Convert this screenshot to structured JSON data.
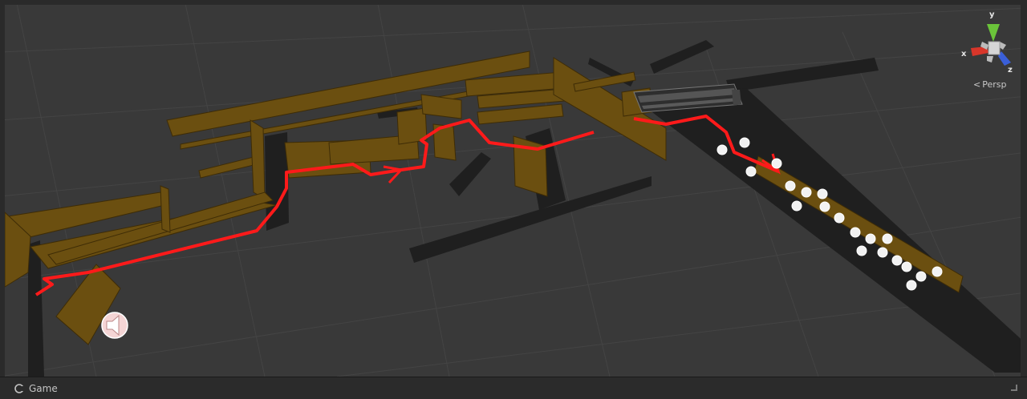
{
  "scene": {
    "gizmo": {
      "x_label": "x",
      "y_label": "y",
      "z_label": "z",
      "projection_label": "Persp"
    },
    "colors": {
      "background": "#393939",
      "path": "#ff1a1a",
      "wall": "#6b4f10",
      "track": "#1e1e1e",
      "lights": "#ffffff"
    }
  },
  "bottom_bar": {
    "tab_label": "Game",
    "tab_icon": "game-controller-icon"
  }
}
